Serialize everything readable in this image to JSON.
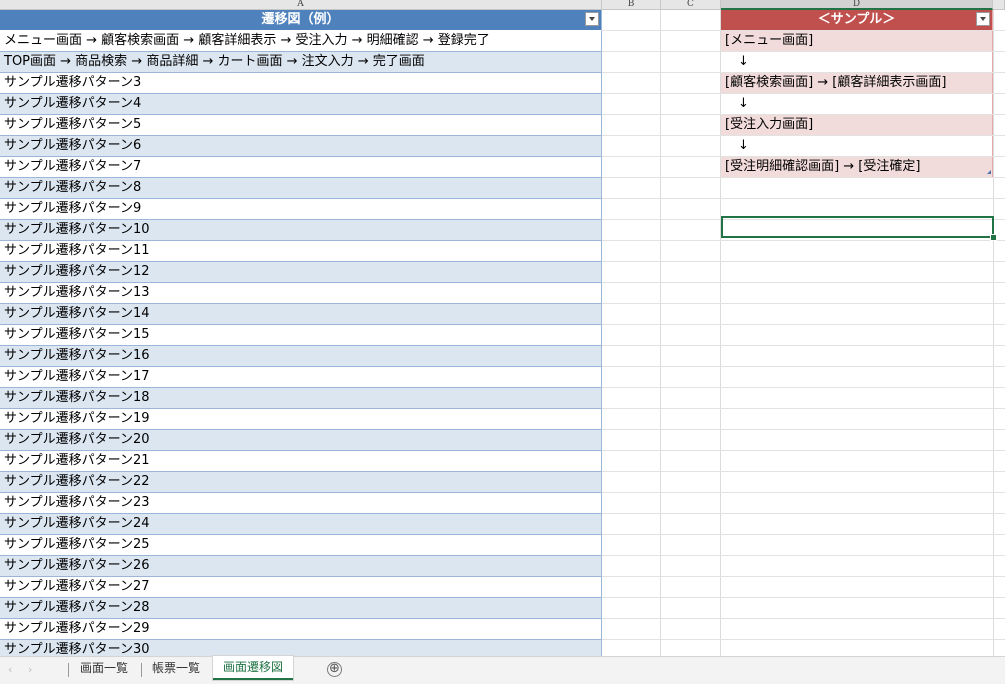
{
  "columns": [
    "A",
    "B",
    "C",
    "D"
  ],
  "table_a": {
    "header": "遷移図（例）",
    "rows": [
      "メニュー画面 → 顧客検索画面 → 顧客詳細表示 → 受注入力 → 明細確認 → 登録完了",
      "TOP画面 → 商品検索 → 商品詳細 → カート画面 → 注文入力 → 完了画面",
      "サンプル遷移パターン3",
      "サンプル遷移パターン4",
      "サンプル遷移パターン5",
      "サンプル遷移パターン6",
      "サンプル遷移パターン7",
      "サンプル遷移パターン8",
      "サンプル遷移パターン9",
      "サンプル遷移パターン10",
      "サンプル遷移パターン11",
      "サンプル遷移パターン12",
      "サンプル遷移パターン13",
      "サンプル遷移パターン14",
      "サンプル遷移パターン15",
      "サンプル遷移パターン16",
      "サンプル遷移パターン17",
      "サンプル遷移パターン18",
      "サンプル遷移パターン19",
      "サンプル遷移パターン20",
      "サンプル遷移パターン21",
      "サンプル遷移パターン22",
      "サンプル遷移パターン23",
      "サンプル遷移パターン24",
      "サンプル遷移パターン25",
      "サンプル遷移パターン26",
      "サンプル遷移パターン27",
      "サンプル遷移パターン28",
      "サンプル遷移パターン29",
      "サンプル遷移パターン30"
    ]
  },
  "table_d": {
    "header": "＜サンプル＞",
    "rows": [
      "[メニュー画面]",
      "　↓",
      "[顧客検索画面] → [顧客詳細表示画面]",
      "　↓",
      "[受注入力画面]",
      "　↓",
      "[受注明細確認画面] → [受注確定]"
    ]
  },
  "sheet_tabs": [
    "画面一覧",
    "帳票一覧",
    "画面遷移図"
  ],
  "active_tab": "画面遷移図",
  "add_sheet_label": "⊕",
  "nav": {
    "left": "‹",
    "right": "›"
  },
  "colors": {
    "table_a_header": "#4f81bd",
    "table_a_band": "#dce6f1",
    "table_d_header": "#c0504d",
    "table_d_band": "#f2dcdb",
    "selection": "#217346"
  }
}
